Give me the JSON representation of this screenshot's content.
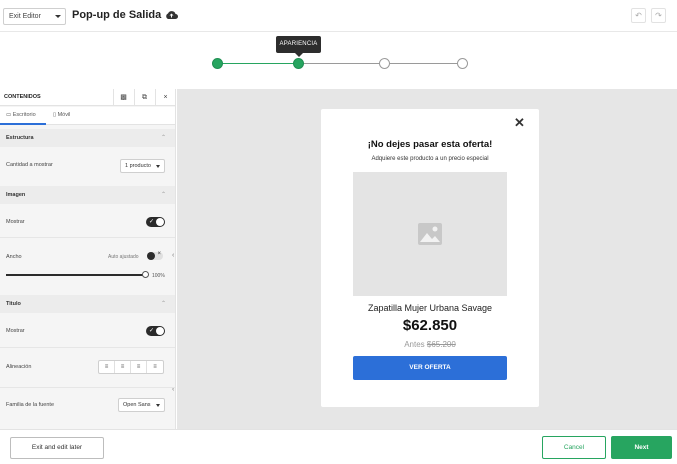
{
  "topbar": {
    "exit_editor": "Exit Editor",
    "title": "Pop-up de Salida",
    "undo_icon": "undo-icon",
    "redo_icon": "redo-icon",
    "cloud_icon": "cloud-upload-icon"
  },
  "stepper": {
    "tooltip": "APARIENCIA",
    "accent": "#27a560"
  },
  "panel": {
    "title": "CONTENIDOS",
    "tabs": {
      "desktop": "Escritorio",
      "mobile": "Móvil"
    },
    "estructura": {
      "header": "Estructura",
      "quantity_label": "Cantidad a mostrar",
      "quantity_value": "1 producto"
    },
    "imagen": {
      "header": "Imagen",
      "show_label": "Mostrar",
      "width_label": "Ancho",
      "auto_label": "Auto ajustado",
      "slider_value": "100%",
      "slider_fraction": 1.0
    },
    "titulo": {
      "header": "Titulo",
      "show_label": "Mostrar",
      "align_label": "Alineación",
      "font_label": "Familia de la fuente",
      "font_value": "Open Sans"
    }
  },
  "popup": {
    "title": "¡No dejes pasar esta oferta!",
    "subtitle": "Adquiere este producto a un precio especial",
    "product_name": "Zapatilla Mujer Urbana Savage",
    "price": "$62.850",
    "before_label": "Antes",
    "old_price": "$65.200",
    "cta": "VER OFERTA",
    "cta_color": "#2c6fd8"
  },
  "footer": {
    "exit_later": "Exit and edit later",
    "cancel": "Cancel",
    "next": "Next"
  }
}
